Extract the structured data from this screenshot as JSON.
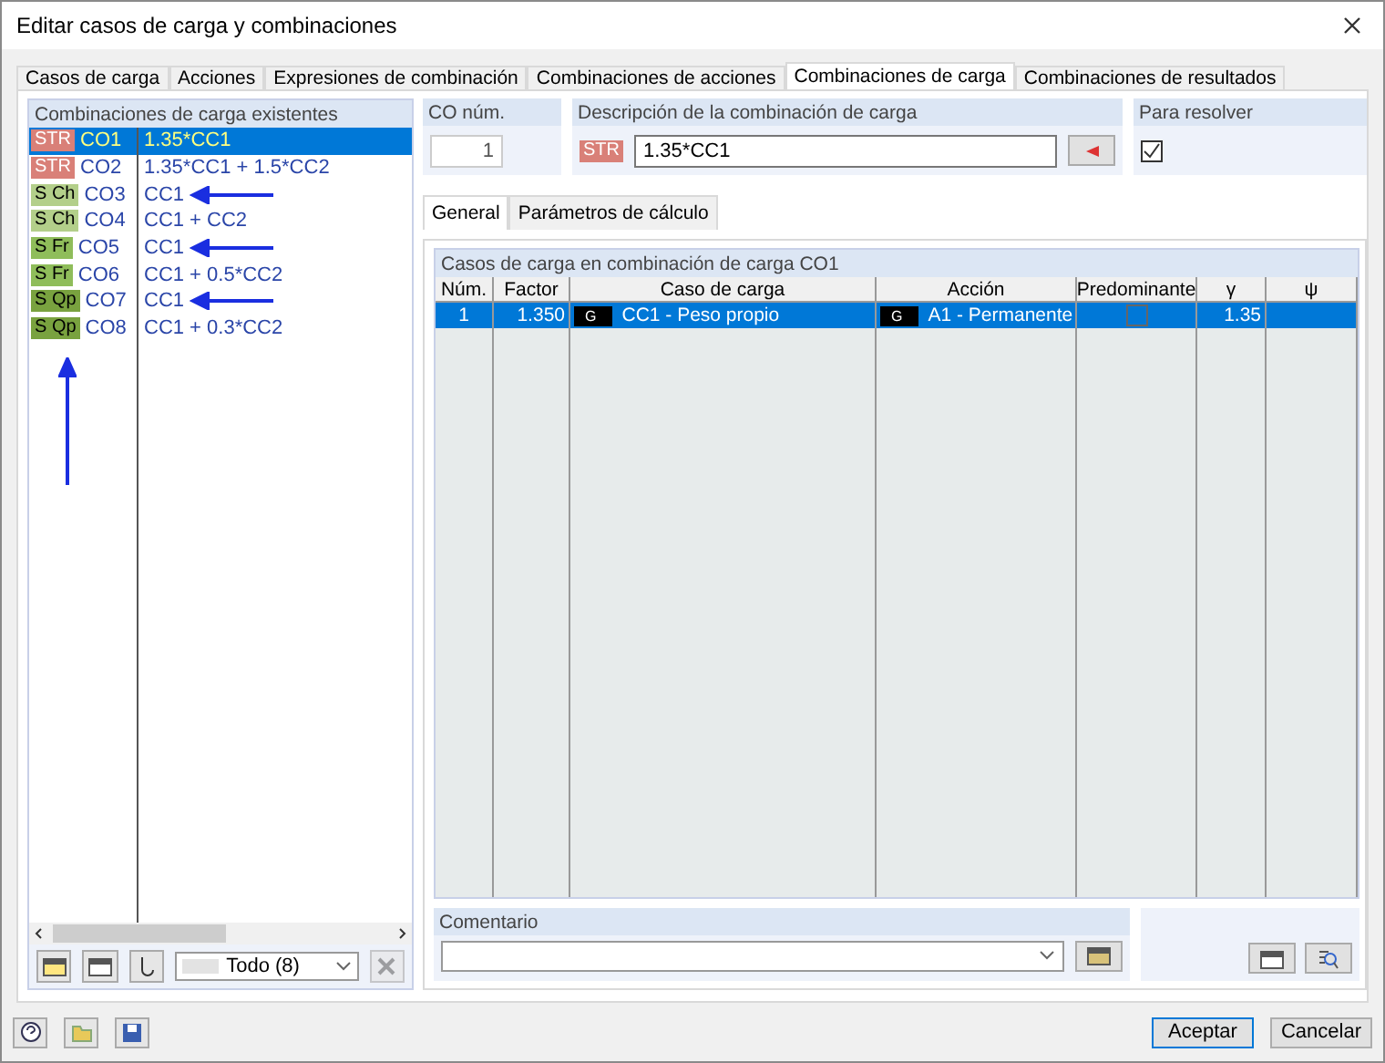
{
  "window": {
    "title": "Editar casos de carga y combinaciones"
  },
  "tabs": [
    {
      "label": "Casos de carga",
      "selected": false
    },
    {
      "label": "Acciones",
      "selected": false
    },
    {
      "label": "Expresiones de combinación",
      "selected": false
    },
    {
      "label": "Combinaciones de acciones",
      "selected": false
    },
    {
      "label": "Combinaciones de carga",
      "selected": true
    },
    {
      "label": "Combinaciones de resultados",
      "selected": false
    }
  ],
  "combinations": {
    "title": "Combinaciones de carga existentes",
    "rows": [
      {
        "tag": "STR",
        "color": "#d98078",
        "id": "CO1",
        "formula": "1.35*CC1",
        "selected": true,
        "arrow": false
      },
      {
        "tag": "STR",
        "color": "#d98078",
        "id": "CO2",
        "formula": "1.35*CC1 + 1.5*CC2",
        "selected": false,
        "arrow": false
      },
      {
        "tag": "S Ch",
        "color": "#b3cf8a",
        "id": "CO3",
        "formula": "CC1",
        "selected": false,
        "arrow": true
      },
      {
        "tag": "S Ch",
        "color": "#b3cf8a",
        "id": "CO4",
        "formula": "CC1 + CC2",
        "selected": false,
        "arrow": false
      },
      {
        "tag": "S Fr",
        "color": "#8fbd5a",
        "id": "CO5",
        "formula": "CC1",
        "selected": false,
        "arrow": true
      },
      {
        "tag": "S Fr",
        "color": "#8fbd5a",
        "id": "CO6",
        "formula": "CC1 + 0.5*CC2",
        "selected": false,
        "arrow": false
      },
      {
        "tag": "S Qp",
        "color": "#79a23f",
        "id": "CO7",
        "formula": "CC1",
        "selected": false,
        "arrow": true
      },
      {
        "tag": "S Qp",
        "color": "#79a23f",
        "id": "CO8",
        "formula": "CC1 + 0.3*CC2",
        "selected": false,
        "arrow": false
      }
    ]
  },
  "filter": {
    "value": "Todo (8)"
  },
  "co_number": {
    "label": "CO núm.",
    "value": "1"
  },
  "description": {
    "label": "Descripción de la combinación de carga",
    "tag": "STR",
    "color": "#d98078",
    "value": "1.35*CC1"
  },
  "to_solve": {
    "label": "Para resolver",
    "checked": true
  },
  "subtabs": [
    {
      "label": "General",
      "selected": true
    },
    {
      "label": "Parámetros de cálculo",
      "selected": false
    }
  ],
  "table": {
    "title": "Casos de carga en combinación de carga CO1",
    "columns": [
      "Núm.",
      "Factor",
      "Caso de carga",
      "Acción",
      "Predominante",
      "γ",
      "ψ"
    ],
    "rows": [
      {
        "num": "1",
        "factor": "1.350",
        "load_case_tag": "G",
        "load_case": "CC1 - Peso propio",
        "action_tag": "G",
        "action": "A1 - Permanente",
        "predominant": false,
        "gamma": "1.35",
        "selected": true
      }
    ]
  },
  "comment": {
    "label": "Comentario"
  },
  "buttons": [
    "Aceptar",
    "Cancelar"
  ]
}
